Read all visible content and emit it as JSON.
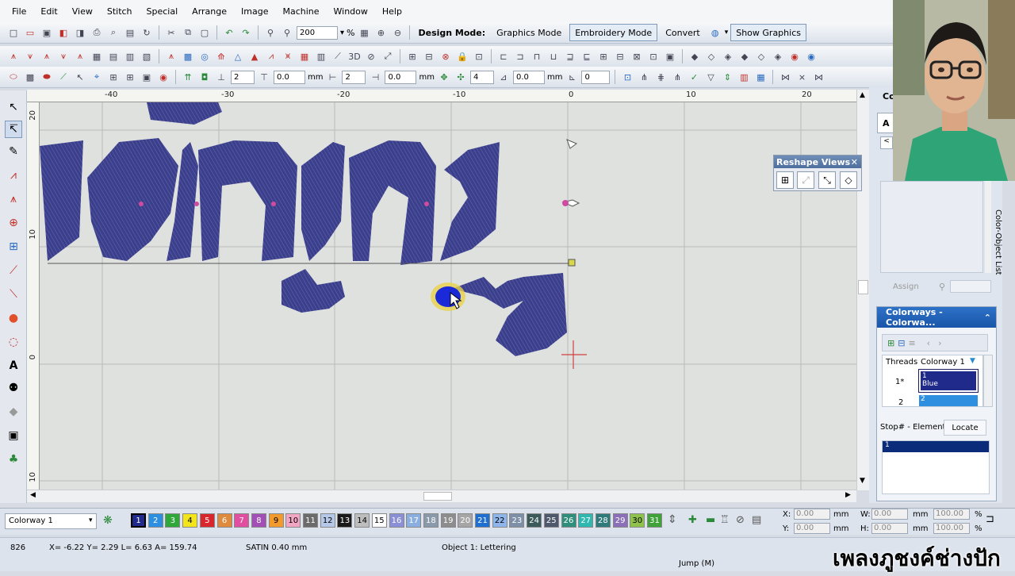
{
  "menu": [
    "File",
    "Edit",
    "View",
    "Stitch",
    "Special",
    "Arrange",
    "Image",
    "Machine",
    "Window",
    "Help"
  ],
  "toolbar": {
    "zoom_value": "200",
    "zoom_unit": "%",
    "design_mode_label": "Design Mode:",
    "graphics_mode": "Graphics Mode",
    "embroidery_mode": "Embroidery Mode",
    "convert": "Convert",
    "show_graphics": "Show Graphics"
  },
  "toolbar3": {
    "f1": "2",
    "f2": "0.0",
    "unit1": "mm",
    "f3": "2",
    "f4": "0.0",
    "unit2": "mm",
    "f5": "4",
    "f6": "0.0",
    "unit3": "mm",
    "f7": "0"
  },
  "ruler": {
    "h_labels": [
      "-40",
      "-30",
      "-20",
      "-10",
      "0",
      "10",
      "20"
    ],
    "v_labels": [
      "20",
      "10",
      "0",
      "10"
    ]
  },
  "reshape": {
    "title": "Reshape Views"
  },
  "right_panel": {
    "tab_partial": "Co",
    "tab_partial2": "A",
    "object_list_label": "Color-Object List",
    "assign": "Assign"
  },
  "colorways": {
    "title": "Colorways - Colorwa...",
    "col_threads": "Threads",
    "col_colorway": "Colorway 1",
    "row1_num": "1*",
    "row1_stop": "1",
    "row1_name": "Blue",
    "row2_num": "2",
    "row2_stop": "2",
    "stop_label": "Stop# - Element",
    "locate": "Locate",
    "list_item": "1"
  },
  "bottom": {
    "colorway_select": "Colorway 1",
    "swatches": [
      {
        "n": "1",
        "c": "#1f2a8a",
        "fg": "#ffffff"
      },
      {
        "n": "2",
        "c": "#2e8fe0",
        "fg": "#ffffff"
      },
      {
        "n": "3",
        "c": "#2fa73a",
        "fg": "#ffffff"
      },
      {
        "n": "4",
        "c": "#f2e51c",
        "fg": "#000000"
      },
      {
        "n": "5",
        "c": "#d9262c",
        "fg": "#ffffff"
      },
      {
        "n": "6",
        "c": "#e08a3e",
        "fg": "#ffffff"
      },
      {
        "n": "7",
        "c": "#e24ea0",
        "fg": "#ffffff"
      },
      {
        "n": "8",
        "c": "#a24fb6",
        "fg": "#ffffff"
      },
      {
        "n": "9",
        "c": "#f29a2b",
        "fg": "#000000"
      },
      {
        "n": "10",
        "c": "#f2a6c4",
        "fg": "#000000"
      },
      {
        "n": "11",
        "c": "#6b6b6b",
        "fg": "#ffffff"
      },
      {
        "n": "12",
        "c": "#b5c8e8",
        "fg": "#000000"
      },
      {
        "n": "13",
        "c": "#1a1a1a",
        "fg": "#ffffff"
      },
      {
        "n": "14",
        "c": "#bdbdbd",
        "fg": "#000000"
      },
      {
        "n": "15",
        "c": "#ffffff",
        "fg": "#000000"
      },
      {
        "n": "16",
        "c": "#8a8fd6",
        "fg": "#ffffff"
      },
      {
        "n": "17",
        "c": "#8aaee0",
        "fg": "#ffffff"
      },
      {
        "n": "18",
        "c": "#8b9aaa",
        "fg": "#ffffff"
      },
      {
        "n": "19",
        "c": "#8d8d8d",
        "fg": "#ffffff"
      },
      {
        "n": "20",
        "c": "#a6a6a6",
        "fg": "#ffffff"
      },
      {
        "n": "21",
        "c": "#1e6fd0",
        "fg": "#ffffff"
      },
      {
        "n": "22",
        "c": "#8fb6ea",
        "fg": "#000000"
      },
      {
        "n": "23",
        "c": "#7e8fa8",
        "fg": "#ffffff"
      },
      {
        "n": "24",
        "c": "#3c5a5a",
        "fg": "#ffffff"
      },
      {
        "n": "25",
        "c": "#4e5a6b",
        "fg": "#ffffff"
      },
      {
        "n": "26",
        "c": "#2f8f7a",
        "fg": "#ffffff"
      },
      {
        "n": "27",
        "c": "#2fb8b0",
        "fg": "#ffffff"
      },
      {
        "n": "28",
        "c": "#2f7a7a",
        "fg": "#ffffff"
      },
      {
        "n": "29",
        "c": "#8b6fb8",
        "fg": "#ffffff"
      },
      {
        "n": "30",
        "c": "#8fc24a",
        "fg": "#000000"
      },
      {
        "n": "31",
        "c": "#3fa33a",
        "fg": "#ffffff"
      }
    ],
    "x_label": "X:",
    "x_val": "0.00",
    "x_unit": "mm",
    "y_label": "Y:",
    "y_val": "0.00",
    "y_unit": "mm",
    "w_label": "W:",
    "w_val": "0.00",
    "w_unit": "mm",
    "w_pct": "100.00",
    "w_pct_unit": "%",
    "h_label": "H:",
    "h_val": "0.00",
    "h_unit": "mm",
    "h_pct": "100.00",
    "h_pct_unit": "%"
  },
  "status": {
    "stitch_count": "826",
    "coords": "X= -6.22 Y= 2.29 L= 6.63 A= 159.74",
    "stitch_type": "SATIN 0.40 mm",
    "object": "Object 1: Lettering",
    "jump": "Jump (M)"
  },
  "overlay_caption": "เพลงภูชงค์ช่างปัก",
  "colors": {
    "embroidery": "#3b3f8a",
    "selected_stitch": "#1a2ad8",
    "highlight": "#e8d24a"
  }
}
